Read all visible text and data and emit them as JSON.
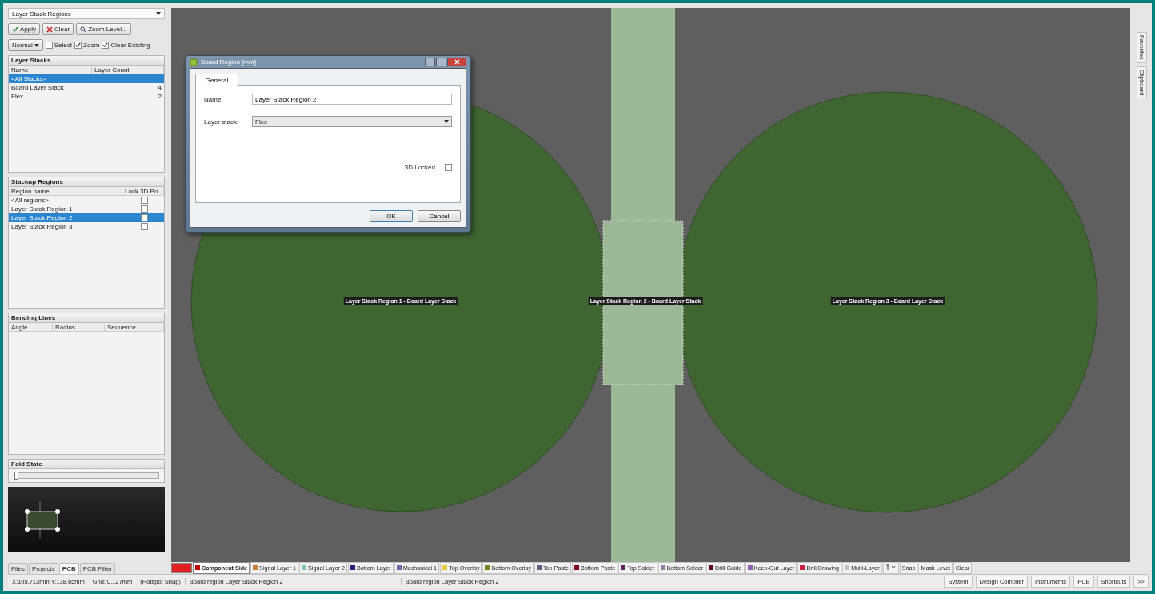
{
  "panel": {
    "title": "Layer Stack Regions",
    "buttons": [
      {
        "label": "Apply",
        "kind": "apply"
      },
      {
        "label": "Clear",
        "kind": "clear"
      },
      {
        "label": "Zoom Level...",
        "kind": "zoom"
      }
    ],
    "mode": "Normal",
    "options": [
      {
        "label": "Select",
        "checked": false
      },
      {
        "label": "Zoom",
        "checked": true
      },
      {
        "label": "Clear Existing",
        "checked": true
      }
    ],
    "layer_stacks": {
      "title": "Layer Stacks",
      "columns": [
        "Name",
        "Layer Count"
      ],
      "rows": [
        {
          "name": "<All Stacks>",
          "count": "",
          "selected": true
        },
        {
          "name": "Board Layer Stack",
          "count": "4",
          "selected": false
        },
        {
          "name": "Flex",
          "count": "2",
          "selected": false
        }
      ]
    },
    "stackup_regions": {
      "title": "Stackup Regions",
      "columns": [
        "Region name",
        "Lock 3D Po..."
      ],
      "rows": [
        {
          "name": "<All regions>",
          "locked": false,
          "selected": false
        },
        {
          "name": "Layer Stack Region 1",
          "locked": false,
          "selected": false
        },
        {
          "name": "Layer Stack Region 2",
          "locked": false,
          "selected": true
        },
        {
          "name": "Layer Stack Region 3",
          "locked": false,
          "selected": false
        }
      ]
    },
    "bending_lines": {
      "title": "Bending Lines",
      "columns": [
        "Angle",
        "Radius",
        "Sequence"
      ]
    },
    "fold_state": {
      "title": "Fold State",
      "level": 0
    },
    "tabs": [
      {
        "label": "Files",
        "selected": false
      },
      {
        "label": "Projects",
        "selected": false
      },
      {
        "label": "PCB",
        "selected": true
      },
      {
        "label": "PCB Filter",
        "selected": false
      }
    ]
  },
  "canvas": {
    "labels": [
      "Layer Stack Region 1 - Board Layer Stack",
      "Layer Stack Region 2 - Board Layer Stack",
      "Layer Stack Region 3 - Board Layer Stack"
    ]
  },
  "dialog": {
    "title": "Board Region [mm]",
    "tab": "General",
    "name_label": "Name",
    "name_value": "Layer Stack Region 2",
    "stack_label": "Layer stack",
    "stack_value": "Flex",
    "locked_label": "3D Locked",
    "locked": false,
    "buttons": [
      "OK",
      "Cancel"
    ]
  },
  "side_tabs": [
    "Favorites",
    "Clipboard"
  ],
  "layers": [
    {
      "label": "Component Side",
      "color": "#c00000",
      "selected": true
    },
    {
      "label": "Signal Layer 1",
      "color": "#c8803c",
      "selected": false
    },
    {
      "label": "Signal Layer 2",
      "color": "#80c0c8",
      "selected": false
    },
    {
      "label": "Bottom Layer",
      "color": "#202080",
      "selected": false
    },
    {
      "label": "Mechanical 1",
      "color": "#8060a8",
      "selected": false
    },
    {
      "label": "Top Overlay",
      "color": "#e8c840",
      "selected": false
    },
    {
      "label": "Bottom Overlay",
      "color": "#808020",
      "selected": false
    },
    {
      "label": "Top Paste",
      "color": "#606080",
      "selected": false
    },
    {
      "label": "Bottom Paste",
      "color": "#800020",
      "selected": false
    },
    {
      "label": "Top Solder",
      "color": "#602060",
      "selected": false
    },
    {
      "label": "Bottom Solder",
      "color": "#9080a8",
      "selected": false
    },
    {
      "label": "Drill Guide",
      "color": "#600020",
      "selected": false
    },
    {
      "label": "Keep-Out Layer",
      "color": "#9060b0",
      "selected": false
    },
    {
      "label": "Drill Drawing",
      "color": "#c82040",
      "selected": false
    },
    {
      "label": "Multi-Layer",
      "color": "#c0c0c0",
      "selected": false
    }
  ],
  "layer_tools": [
    "Snap",
    "Mask Level",
    "Clear"
  ],
  "status_bar": {
    "coords": "X:105.713mm Y:138.65mm",
    "grid": "Grid: 0.127mm",
    "snap": "(Hotspot Snap)",
    "region_1": "Board region Layer Stack Region 2",
    "region_2": "Board region Layer Stack Region 2",
    "buttons": [
      "System",
      "Design Compiler",
      "Instruments",
      "PCB",
      "Shortcuts",
      ">>"
    ]
  }
}
